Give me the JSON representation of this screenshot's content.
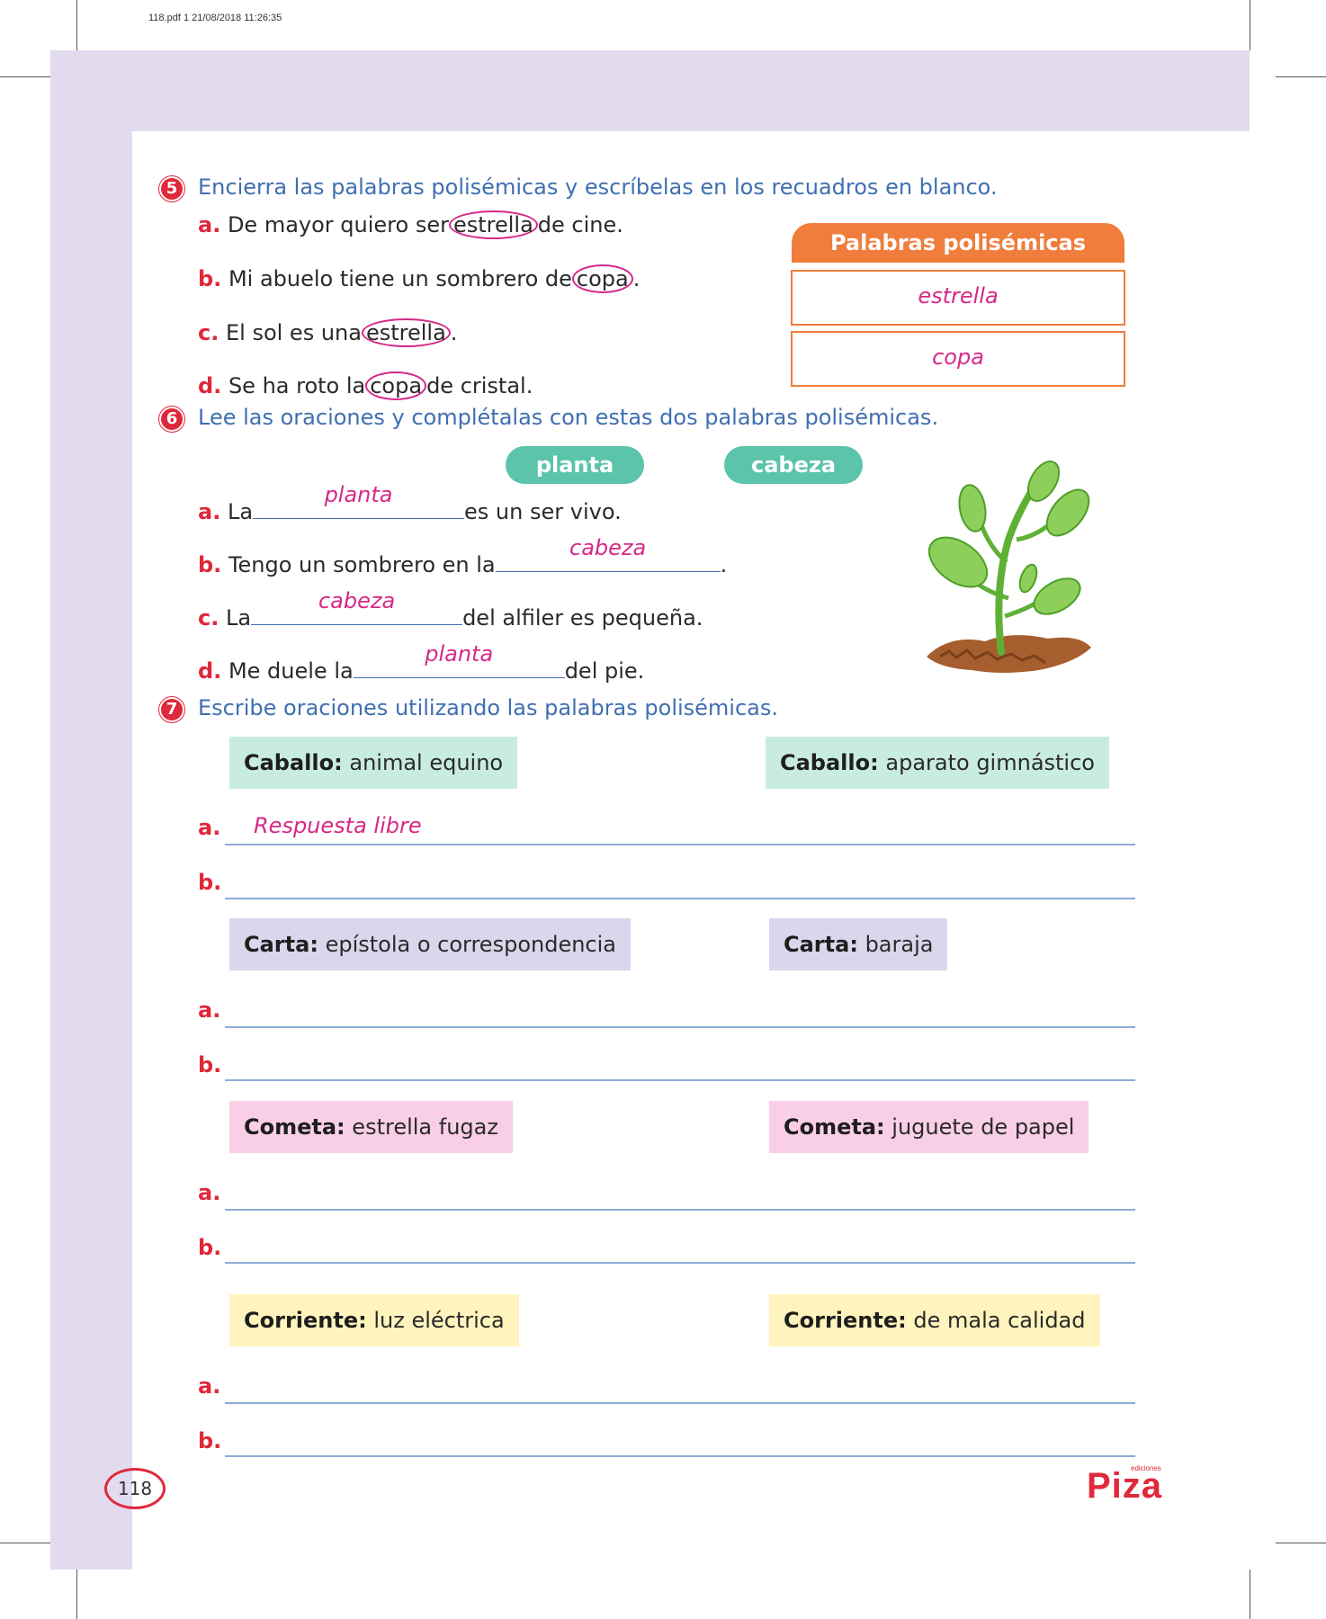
{
  "meta": {
    "pdf_stamp": "118.pdf   1   21/08/2018   11:26:35"
  },
  "q5": {
    "num": "5",
    "instruction": "Encierra las palabras polisémicas y escríbelas en los recuadros en blanco.",
    "items": [
      {
        "label": "a.",
        "before": "De mayor quiero ser",
        "word": "estrella",
        "after": "de cine."
      },
      {
        "label": "b.",
        "before": "Mi abuelo tiene un sombrero de",
        "word": "copa",
        "after": "."
      },
      {
        "label": "c.",
        "before": "El sol es una",
        "word": "estrella",
        "after": "."
      },
      {
        "label": "d.",
        "before": "Se ha roto la",
        "word": "copa",
        "after": "de cristal."
      }
    ],
    "box_title": "Palabras polisémicas",
    "box_answers": [
      "estrella",
      "copa"
    ]
  },
  "q6": {
    "num": "6",
    "instruction": "Lee las oraciones y complétalas con estas dos palabras polisémicas.",
    "chips": [
      "planta",
      "cabeza"
    ],
    "items": [
      {
        "label": "a.",
        "before": "La",
        "answer": "planta",
        "after": "es un ser vivo."
      },
      {
        "label": "b.",
        "before": "Tengo un sombrero en la",
        "answer": "cabeza",
        "after": "."
      },
      {
        "label": "c.",
        "before": "La",
        "answer": "cabeza",
        "after": "del alfiler es pequeña."
      },
      {
        "label": "d.",
        "before": "Me duele la",
        "answer": "planta",
        "after": "del pie."
      }
    ]
  },
  "q7": {
    "num": "7",
    "instruction": "Escribe oraciones utilizando las palabras polisémicas.",
    "groups": [
      {
        "left_term": "Caballo:",
        "left_def": "animal equino",
        "right_term": "Caballo:",
        "right_def": "aparato gimnástico",
        "color": "#c9ece1"
      },
      {
        "left_term": "Carta:",
        "left_def": "epístola o correspondencia",
        "right_term": "Carta:",
        "right_def": "baraja",
        "color": "#dcd6ec"
      },
      {
        "left_term": "Cometa:",
        "left_def": "estrella fugaz",
        "right_term": "Cometa:",
        "right_def": "juguete de papel",
        "color": "#f9cfe7"
      },
      {
        "left_term": "Corriente:",
        "left_def": "luz eléctrica",
        "right_term": "Corriente:",
        "right_def": "de mala calidad",
        "color": "#fff4bd"
      }
    ],
    "line_labels": [
      "a.",
      "b."
    ],
    "sample_answer": "Respuesta libre"
  },
  "footer": {
    "page_number": "118",
    "logo": "Piza",
    "logo_small": "ediciones"
  },
  "colors": {
    "accent_red": "#e0283b",
    "instruction_blue": "#3f6fb0",
    "answer_pink": "#d62888",
    "band_lavender": "#e2dbef",
    "orange": "#f07d3c",
    "teal": "#5bc4ab"
  }
}
